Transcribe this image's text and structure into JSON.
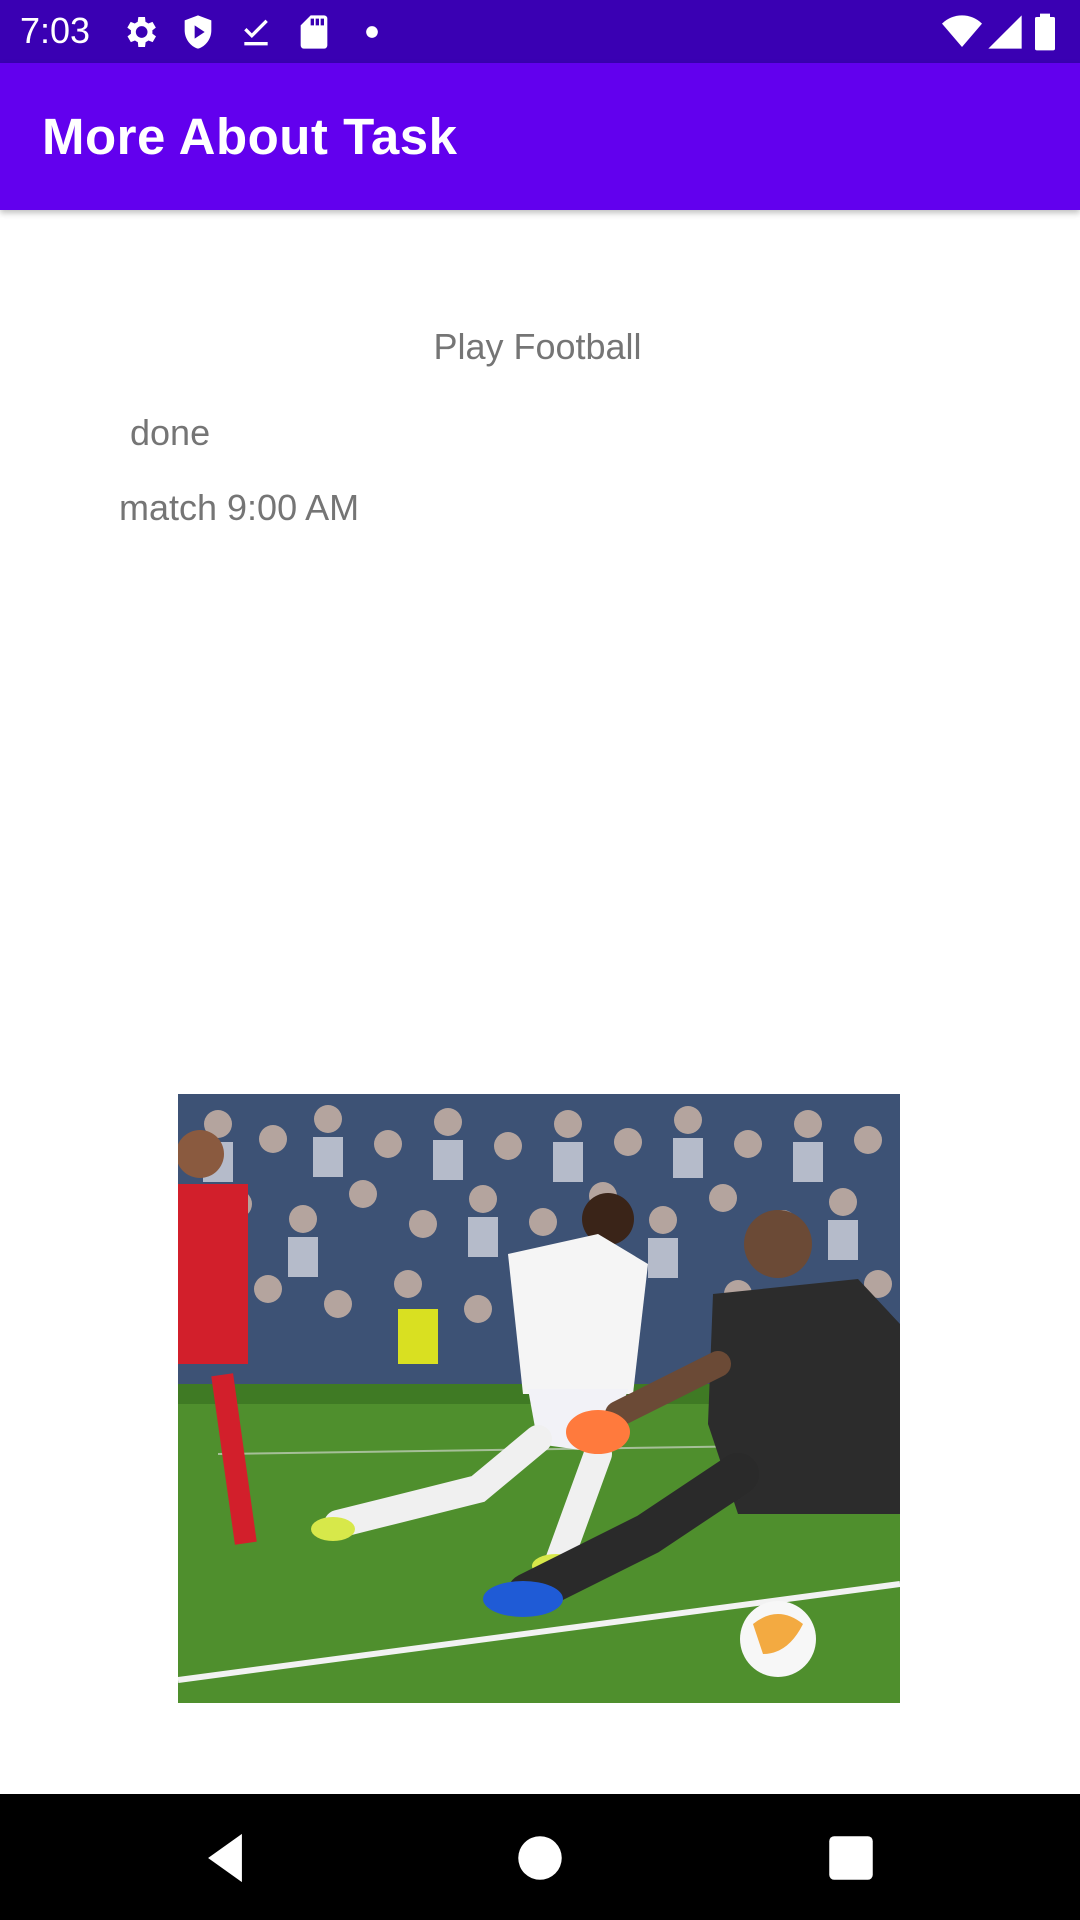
{
  "status_bar": {
    "time": "7:03",
    "icons": [
      "settings-icon",
      "shield-play-icon",
      "download-done-icon",
      "sd-card-icon",
      "dot-icon",
      "wifi-icon",
      "signal-icon",
      "battery-icon"
    ]
  },
  "app_bar": {
    "title": "More About Task",
    "color": "#6200ee"
  },
  "task": {
    "title": "Play Football",
    "status": "done",
    "description": "match 9:00 AM",
    "image": "football-match-photo"
  },
  "nav_bar": {
    "buttons": [
      "back-icon",
      "home-icon",
      "recents-icon"
    ]
  },
  "colors": {
    "status_bar": "#3a00b3",
    "app_bar": "#6200ee",
    "text_secondary": "#757575"
  }
}
